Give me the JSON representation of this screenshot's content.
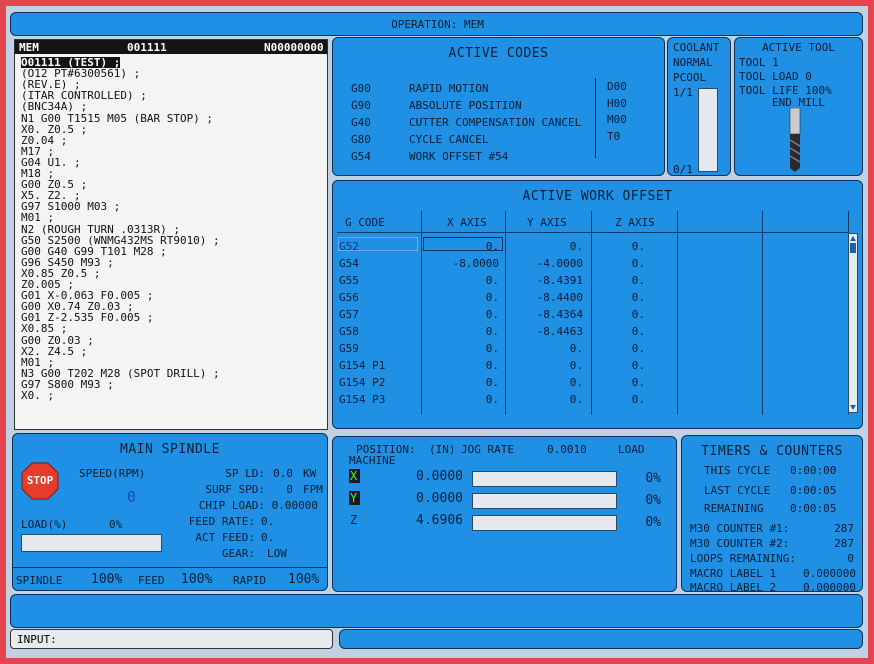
{
  "header": {
    "operation": "OPERATION: MEM"
  },
  "program": {
    "mode": "MEM",
    "number": "001111",
    "sequence": "N00000000",
    "lines": [
      "O01111 (TEST) ;",
      "(O12 PT#6300561) ;",
      "(REV.E) ;",
      "(ITAR CONTROLLED) ;",
      "(BNC34A) ;",
      "N1 G00 T1515 M05 (BAR STOP) ;",
      "X0. Z0.5 ;",
      "Z0.04 ;",
      "M17 ;",
      "G04 U1. ;",
      "M18 ;",
      "G00 Z0.5 ;",
      "X5. Z2. ;",
      "G97 S1000 M03 ;",
      "M01 ;",
      "N2 (ROUGH TURN .0313R) ;",
      "G50 S2500 (WNMG432MS RT9010) ;",
      "G00 G40 G99 T101 M28 ;",
      "G96 S450 M93 ;",
      "X0.85 Z0.5 ;",
      "Z0.005 ;",
      "G01 X-0.063 F0.005 ;",
      "G00 X0.74 Z0.03 ;",
      "G01 Z-2.535 F0.005 ;",
      "X0.85 ;",
      "G00 Z0.03 ;",
      "X2. Z4.5 ;",
      "M01 ;",
      "N3 G00 T202 M28 (SPOT DRILL) ;",
      "G97 S800 M93 ;",
      "X0. ;"
    ]
  },
  "active_codes": {
    "title": "ACTIVE CODES",
    "rows": [
      {
        "code": "G00",
        "desc": "RAPID MOTION"
      },
      {
        "code": "G90",
        "desc": "ABSOLUTE POSITION"
      },
      {
        "code": "G40",
        "desc": "CUTTER COMPENSATION CANCEL"
      },
      {
        "code": "G80",
        "desc": "CYCLE CANCEL"
      },
      {
        "code": "G54",
        "desc": "WORK OFFSET #54"
      }
    ],
    "right_codes": [
      "D00",
      "H00",
      "M00",
      "T0"
    ]
  },
  "coolant": {
    "title": "COOLANT",
    "status": "NORMAL",
    "pcool": "PCOOL",
    "top": "1/1",
    "bottom": "0/1"
  },
  "active_tool": {
    "title": "ACTIVE TOOL",
    "tool": "TOOL 1",
    "load": "TOOL LOAD 0",
    "life": "TOOL LIFE 100%",
    "type": "END MILL"
  },
  "work_offset": {
    "title": "ACTIVE WORK OFFSET",
    "headers": [
      "G CODE",
      "X AXIS",
      "Y AXIS",
      "Z AXIS"
    ],
    "rows": [
      {
        "g": "G52",
        "x": "0.",
        "y": "0.",
        "z": "0."
      },
      {
        "g": "G54",
        "x": "-8.0000",
        "y": "-4.0000",
        "z": "0."
      },
      {
        "g": "G55",
        "x": "0.",
        "y": "-8.4391",
        "z": "0."
      },
      {
        "g": "G56",
        "x": "0.",
        "y": "-8.4400",
        "z": "0."
      },
      {
        "g": "G57",
        "x": "0.",
        "y": "-8.4364",
        "z": "0."
      },
      {
        "g": "G58",
        "x": "0.",
        "y": "-8.4463",
        "z": "0."
      },
      {
        "g": "G59",
        "x": "0.",
        "y": "0.",
        "z": "0."
      },
      {
        "g": "G154 P1",
        "x": "0.",
        "y": "0.",
        "z": "0."
      },
      {
        "g": "G154 P2",
        "x": "0.",
        "y": "0.",
        "z": "0."
      },
      {
        "g": "G154 P3",
        "x": "0.",
        "y": "0.",
        "z": "0."
      }
    ]
  },
  "spindle": {
    "title": "MAIN SPINDLE",
    "stop": "STOP",
    "speed_label": "SPEED(RPM)",
    "speed": "0",
    "load_label": "LOAD(%)",
    "load": "0%",
    "sp_ld_label": "SP LD:",
    "sp_ld": "0.0",
    "sp_ld_unit": "KW",
    "surf_label": "SURF SPD:",
    "surf": "0",
    "surf_unit": "FPM",
    "chip_label": "CHIP LOAD:",
    "chip": "0.00000",
    "feed_label": "FEED RATE:",
    "feed": "0.",
    "act_label": "ACT FEED:",
    "act": "0.",
    "gear_label": "GEAR:",
    "gear": "LOW",
    "ov_spindle_label": "SPINDLE",
    "ov_spindle": "100%",
    "ov_feed_label": "FEED",
    "ov_feed": "100%",
    "ov_rapid_label": "RAPID",
    "ov_rapid": "100%"
  },
  "position": {
    "label": "POSITION:",
    "unit": "(IN)",
    "jog_label": "JOG RATE",
    "jog": "0.0010",
    "load_label": "LOAD",
    "mode": "MACHINE",
    "axes": [
      {
        "axis": "X",
        "value": "0.0000",
        "load": "0%"
      },
      {
        "axis": "Y",
        "value": "0.0000",
        "load": "0%"
      },
      {
        "axis": "Z",
        "value": "4.6906",
        "load": "0%"
      }
    ]
  },
  "timers": {
    "title": "TIMERS & COUNTERS",
    "this_label": "THIS CYCLE",
    "this": "0:00:00",
    "last_label": "LAST CYCLE",
    "last": "0:00:05",
    "rem_label": "REMAINING",
    "rem": "0:00:05",
    "m30_1_label": "M30 COUNTER #1:",
    "m30_1": "287",
    "m30_2_label": "M30 COUNTER #2:",
    "m30_2": "287",
    "loops_label": "LOOPS REMAINING:",
    "loops": "0",
    "macro1_label": "MACRO LABEL 1",
    "macro1": "0.000000",
    "macro2_label": "MACRO LABEL 2",
    "macro2": "0.000000"
  },
  "input": {
    "label": "INPUT:"
  },
  "colors": {
    "panel": "#1f90e3",
    "screen": "#bfd1e3",
    "bezel": "#e4464e",
    "stop": "#e63c2b"
  }
}
